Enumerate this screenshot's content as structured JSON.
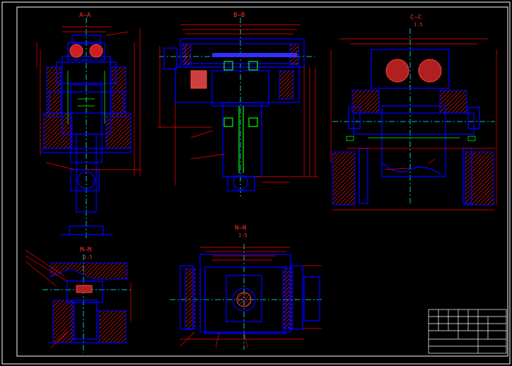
{
  "views": {
    "aa": {
      "title": "A—A"
    },
    "bb": {
      "title": "B—B"
    },
    "cc": {
      "title": "C—C",
      "scale": "1:5"
    },
    "mm": {
      "title": "M—M",
      "scale": "1:5"
    },
    "nn": {
      "title": "N—N",
      "scale": "1:5"
    }
  },
  "colors": {
    "background": "#000000",
    "border": "#ffffff",
    "outline": "#0000ff",
    "dimension": "#ff0000",
    "centerline": "#00ffff",
    "part": "#00c800",
    "hatch": "#ff3030",
    "text": "#ffffff"
  }
}
